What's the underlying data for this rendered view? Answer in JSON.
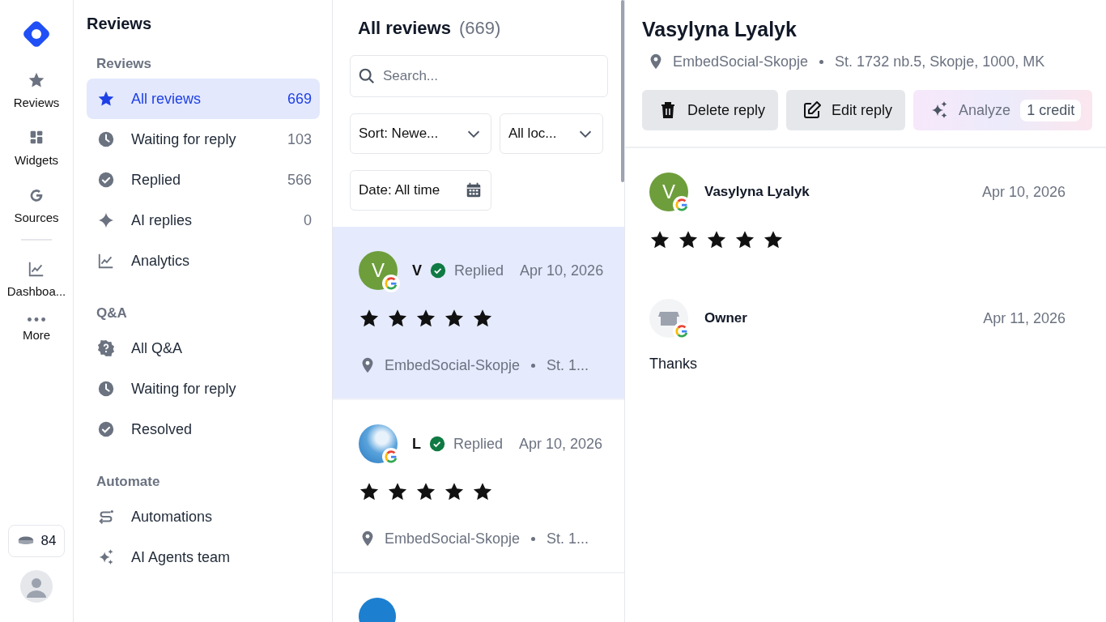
{
  "rail": {
    "items": [
      {
        "label": "Reviews",
        "kind": "star"
      },
      {
        "label": "Widgets",
        "kind": "widgets"
      },
      {
        "label": "Sources",
        "kind": "google"
      },
      {
        "label": "Dashboa...",
        "kind": "chart"
      },
      {
        "label": "More",
        "kind": "dots"
      }
    ],
    "credits": "84"
  },
  "nav": {
    "title": "Reviews",
    "sections": [
      {
        "heading": "Reviews",
        "items": [
          {
            "label": "All reviews",
            "count": "669",
            "kind": "star",
            "selected": true
          },
          {
            "label": "Waiting for reply",
            "count": "103",
            "kind": "clock",
            "selected": false
          },
          {
            "label": "Replied",
            "count": "566",
            "kind": "check",
            "selected": false
          },
          {
            "label": "AI replies",
            "count": "0",
            "kind": "sparkle",
            "selected": false
          },
          {
            "label": "Analytics",
            "kind": "chart",
            "selected": false
          }
        ]
      },
      {
        "heading": "Q&A",
        "items": [
          {
            "label": "All Q&A",
            "kind": "question",
            "selected": false
          },
          {
            "label": "Waiting for reply",
            "kind": "clock",
            "selected": false
          },
          {
            "label": "Resolved",
            "kind": "check",
            "selected": false
          }
        ]
      },
      {
        "heading": "Automate",
        "items": [
          {
            "label": "Automations",
            "kind": "automation",
            "selected": false
          },
          {
            "label": "AI Agents team",
            "kind": "sparkles",
            "selected": false
          }
        ]
      }
    ]
  },
  "list": {
    "title": "All reviews",
    "count": "(669)",
    "search": {
      "placeholder": "Search..."
    },
    "filters": [
      "Sort: Newe...",
      "All loc..."
    ],
    "date_filter": "Date: All time",
    "reviews": [
      {
        "kind": "letter",
        "initial": "V",
        "name": "V",
        "status": "Replied",
        "date": "Apr 10, 2026",
        "stars": 5,
        "location": "EmbedSocial-Skopje",
        "address": "St. 1...",
        "selected": true
      },
      {
        "kind": "photo",
        "name": "L",
        "status": "Replied",
        "date": "Apr 10, 2026",
        "stars": 5,
        "location": "EmbedSocial-Skopje",
        "address": "St. 1...",
        "selected": false
      }
    ]
  },
  "detail": {
    "name": "Vasylyna Lyalyk",
    "location": "EmbedSocial-Skopje",
    "address": "St. 1732 nb.5, Skopje, 1000, MK",
    "actions": [
      {
        "label": "Delete reply",
        "kind": "delete"
      },
      {
        "label": "Edit reply",
        "kind": "edit"
      },
      {
        "label": "Analyze",
        "kind": "analyze",
        "badge": "1 credit"
      }
    ],
    "review": {
      "initial": "V",
      "author": "Vasylyna Lyalyk",
      "date": "Apr 10, 2026",
      "stars": 5
    },
    "reply": {
      "author": "Owner",
      "date": "Apr 11, 2026",
      "text": "Thanks"
    }
  }
}
